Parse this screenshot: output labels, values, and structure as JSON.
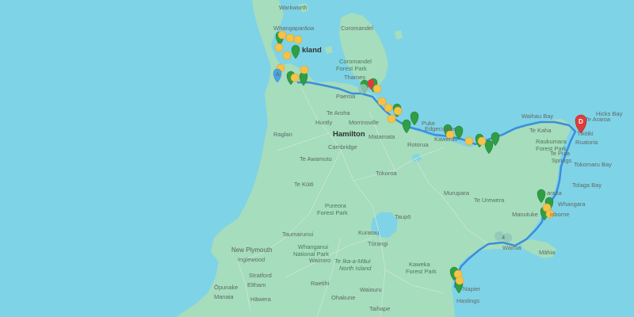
{
  "map": {
    "colors": {
      "water": "#7fd3e6",
      "land": "#a5ddbd",
      "route": "#3b8edb",
      "marker_green": "#2f9e44",
      "marker_yellow": "#f5c24a",
      "marker_blue": "#4aa3e3",
      "marker_red": "#e03b3b"
    },
    "labels": {
      "warkworth": "Warkworth",
      "whangaparaoa": "Whangaparāoa",
      "coromandel": "Coromandel",
      "auckland": "kland",
      "coromandel_fp": "Coromandel",
      "forest_park": "Forest Park",
      "thames": "Thames",
      "paeroa": "Paeroa",
      "te_aroha": "Te Aroha",
      "huntly": "Huntly",
      "morrinsville": "Morrinsville",
      "raglan": "Raglan",
      "hamilton": "Hamilton",
      "cambridge": "Cambridge",
      "matamata": "Matamata",
      "te_awamutu": "Te Awamutu",
      "tokoroa": "Tokoroa",
      "te_kuiti": "Te Kūiti",
      "rotorua": "Rotorua",
      "edgecumbe": "Edgecumbe",
      "kawerau": "Kawerau",
      "puke": "Puke",
      "murupara": "Murupara",
      "te_urewera": "Te Urewera",
      "pureora": "Pureora",
      "pureora_fp": "Forest Park",
      "taupo": "Taupō",
      "taumarunui": "Taumarunui",
      "kuratau": "Kuratau",
      "turangi": "Tūrangi",
      "new_plymouth": "New Plymouth",
      "inglewood": "Inglewood",
      "whanganui": "Whanganui",
      "whanganui_np": "National Park",
      "waimiro": "Waimiro",
      "stratford": "Stratford",
      "eltham": "Eltham",
      "opunake": "Ōpunake",
      "manaia": "Manaia",
      "hawera": "Hāwera",
      "raetihi": "Raetihi",
      "ohakune": "Ohakune",
      "waiouru": "Waiouru",
      "taihape": "Taihape",
      "te_ika": "Te Ika-a-Māui",
      "north_island": "North Island",
      "kaweka": "Kaweka",
      "kaweka_fp": "Forest Park",
      "napier": "Napier",
      "hastings": "Hastings",
      "wairoa": "Wairoa",
      "mahia": "Māhia",
      "manutuke": "Manutuke",
      "gisborne": "isborne",
      "whangara": "Whangara",
      "tolaga_bay": "Tolaga Bay",
      "tokomaru_bay": "Tokomaru Bay",
      "te_puia_springs": "Te Puia",
      "springs": "Springs",
      "ruatoria": "Ruatoria",
      "tikitiki": "Tikitiki",
      "te_araroa": "Te Araroa",
      "hicks_bay": "Hicks Bay",
      "waihau_bay": "Waihau Bay",
      "te_kaha": "Te Kaha",
      "raukumara": "Raukumara",
      "raukumara_fp": "Forest Park",
      "te_karaka": "araka"
    },
    "markers": {
      "destination_letter": "D",
      "blue_label": "A",
      "wairoa_label": "4"
    }
  }
}
